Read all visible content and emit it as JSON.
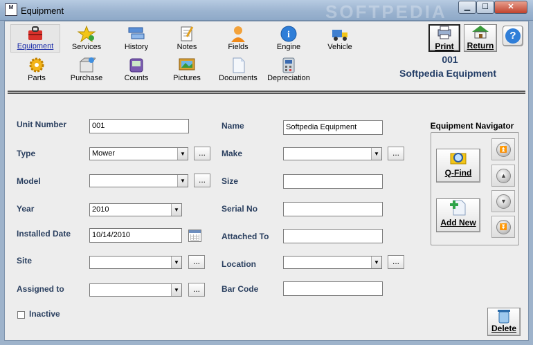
{
  "window": {
    "title": "Equipment",
    "watermark": "SOFTPEDIA",
    "app_icon_text": "M"
  },
  "toolbar": {
    "row1": [
      {
        "label": "Equipment",
        "icon": "toolbox-icon",
        "active": true
      },
      {
        "label": "Services",
        "icon": "star-icon"
      },
      {
        "label": "History",
        "icon": "history-icon"
      },
      {
        "label": "Notes",
        "icon": "notes-icon"
      },
      {
        "label": "Fields",
        "icon": "person-icon"
      },
      {
        "label": "Engine",
        "icon": "info-icon"
      },
      {
        "label": "Vehicle",
        "icon": "truck-icon"
      }
    ],
    "row2": [
      {
        "label": "Parts",
        "icon": "gear-icon"
      },
      {
        "label": "Purchase",
        "icon": "box-icon"
      },
      {
        "label": "Counts",
        "icon": "counter-icon"
      },
      {
        "label": "Pictures",
        "icon": "picture-icon"
      },
      {
        "label": "Documents",
        "icon": "document-icon"
      },
      {
        "label": "Depreciation",
        "icon": "calculator-icon"
      }
    ],
    "print_label": "Print",
    "return_label": "Return",
    "help_label": "?"
  },
  "header": {
    "equipment_number": "001",
    "equipment_name": "Softpedia Equipment"
  },
  "form": {
    "unit_number": {
      "label": "Unit Number",
      "value": "001"
    },
    "name": {
      "label": "Name",
      "value": "Softpedia Equipment"
    },
    "type": {
      "label": "Type",
      "value": "Mower"
    },
    "make": {
      "label": "Make",
      "value": ""
    },
    "model": {
      "label": "Model",
      "value": ""
    },
    "size": {
      "label": "Size",
      "value": ""
    },
    "year": {
      "label": "Year",
      "value": "2010"
    },
    "serial_no": {
      "label": "Serial No",
      "value": ""
    },
    "installed_date": {
      "label": "Installed Date",
      "value": "10/14/2010"
    },
    "attached_to": {
      "label": "Attached To",
      "value": ""
    },
    "site": {
      "label": "Site",
      "value": ""
    },
    "location": {
      "label": "Location",
      "value": ""
    },
    "assigned_to": {
      "label": "Assigned to",
      "value": ""
    },
    "bar_code": {
      "label": "Bar Code",
      "value": ""
    },
    "inactive": {
      "label": "Inactive",
      "checked": false
    },
    "ellipsis": "..."
  },
  "navigator": {
    "title": "Equipment Navigator",
    "qfind_label": "Q-Find",
    "addnew_label": "Add New"
  },
  "delete_label": "Delete"
}
